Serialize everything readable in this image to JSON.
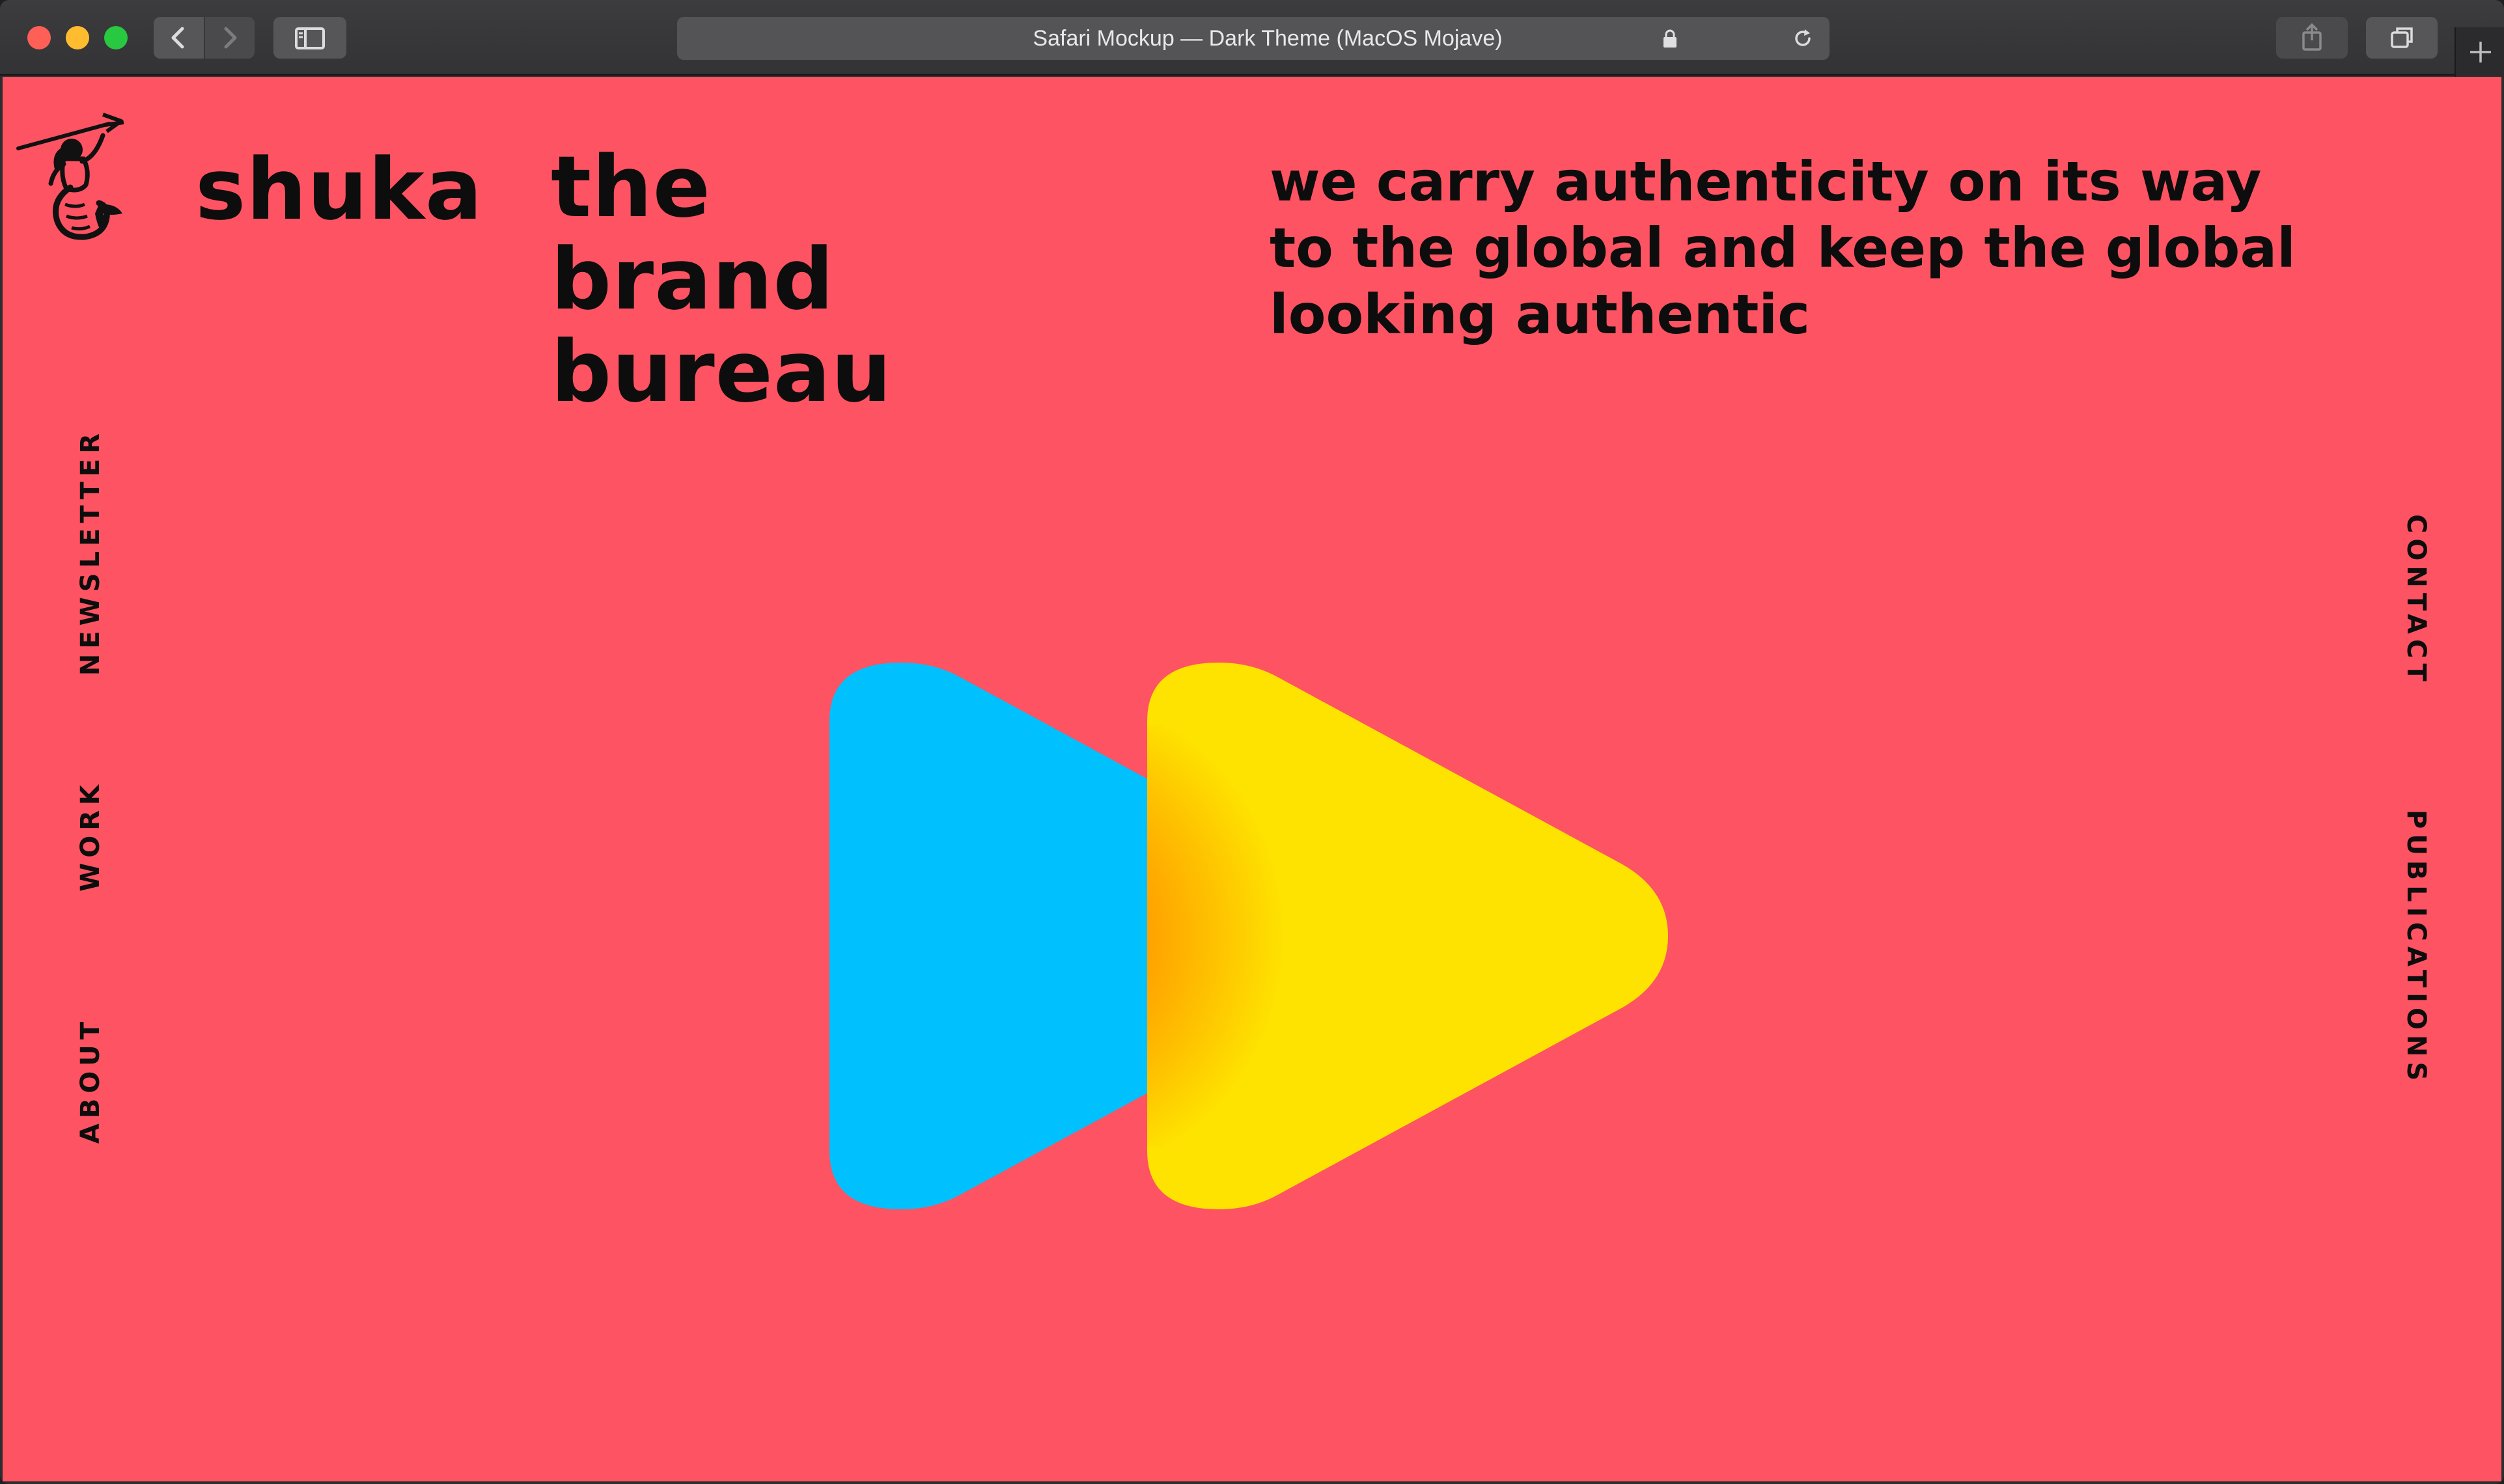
{
  "browser": {
    "address_text": "Safari Mockup — Dark Theme (MacOS Mojave)",
    "icons": [
      "back-chevron-icon",
      "forward-chevron-icon",
      "sidebar-icon",
      "lock-icon",
      "reload-icon",
      "share-icon",
      "tabs-icon",
      "plus-icon"
    ]
  },
  "site": {
    "brand_name": "shuka",
    "brand_title": "the brand bureau",
    "tagline": "we carry authenticity on its way to the global and keep the global looking authentic",
    "logo_icon": "mermaid-icon"
  },
  "nav": {
    "left": [
      "NEWSLETTER",
      "WORK",
      "ABOUT"
    ],
    "right": [
      "CONTACT",
      "PUBLICATIONS"
    ]
  },
  "hero": {
    "icon": "double-play-icon"
  },
  "colors": {
    "page_background": "#fe5362",
    "text": "#0d0d0d",
    "triangle_back": "#00c0fd",
    "triangle_front": "#fee200",
    "overlap": "#ff9400"
  }
}
